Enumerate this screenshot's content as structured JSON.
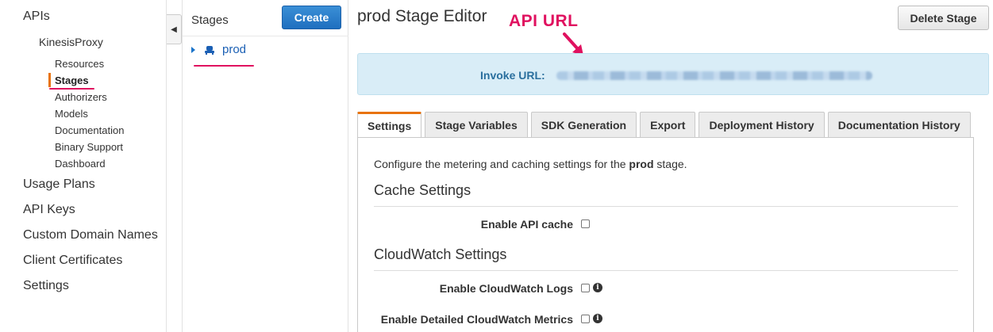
{
  "leftnav": {
    "apis": "APIs",
    "api_name": "KinesisProxy",
    "sub_items": [
      "Resources",
      "Stages",
      "Authorizers",
      "Models",
      "Documentation",
      "Binary Support",
      "Dashboard"
    ],
    "active_sub": "Stages",
    "main_items": [
      "Usage Plans",
      "API Keys",
      "Custom Domain Names",
      "Client Certificates",
      "Settings"
    ]
  },
  "stages": {
    "title": "Stages",
    "create_label": "Create",
    "items": [
      "prod"
    ]
  },
  "main": {
    "title": "prod Stage Editor",
    "annotation": "API URL",
    "delete_label": "Delete Stage",
    "invoke_label": "Invoke URL:",
    "invoke_url_redacted": "",
    "tabs": [
      "Settings",
      "Stage Variables",
      "SDK Generation",
      "Export",
      "Deployment History",
      "Documentation History"
    ],
    "active_tab": "Settings",
    "settings": {
      "desc_prefix": "Configure the metering and caching settings for the ",
      "desc_stage": "prod",
      "desc_suffix": " stage.",
      "cache_heading": "Cache Settings",
      "enable_cache_label": "Enable API cache",
      "cloudwatch_heading": "CloudWatch Settings",
      "enable_logs_label": "Enable CloudWatch Logs",
      "enable_metrics_label": "Enable Detailed CloudWatch Metrics"
    }
  },
  "colors": {
    "accent_orange": "#e8730d",
    "annotation_pink": "#e0115f",
    "link_blue": "#1a5fb4",
    "info_bg": "#d9edf7"
  }
}
